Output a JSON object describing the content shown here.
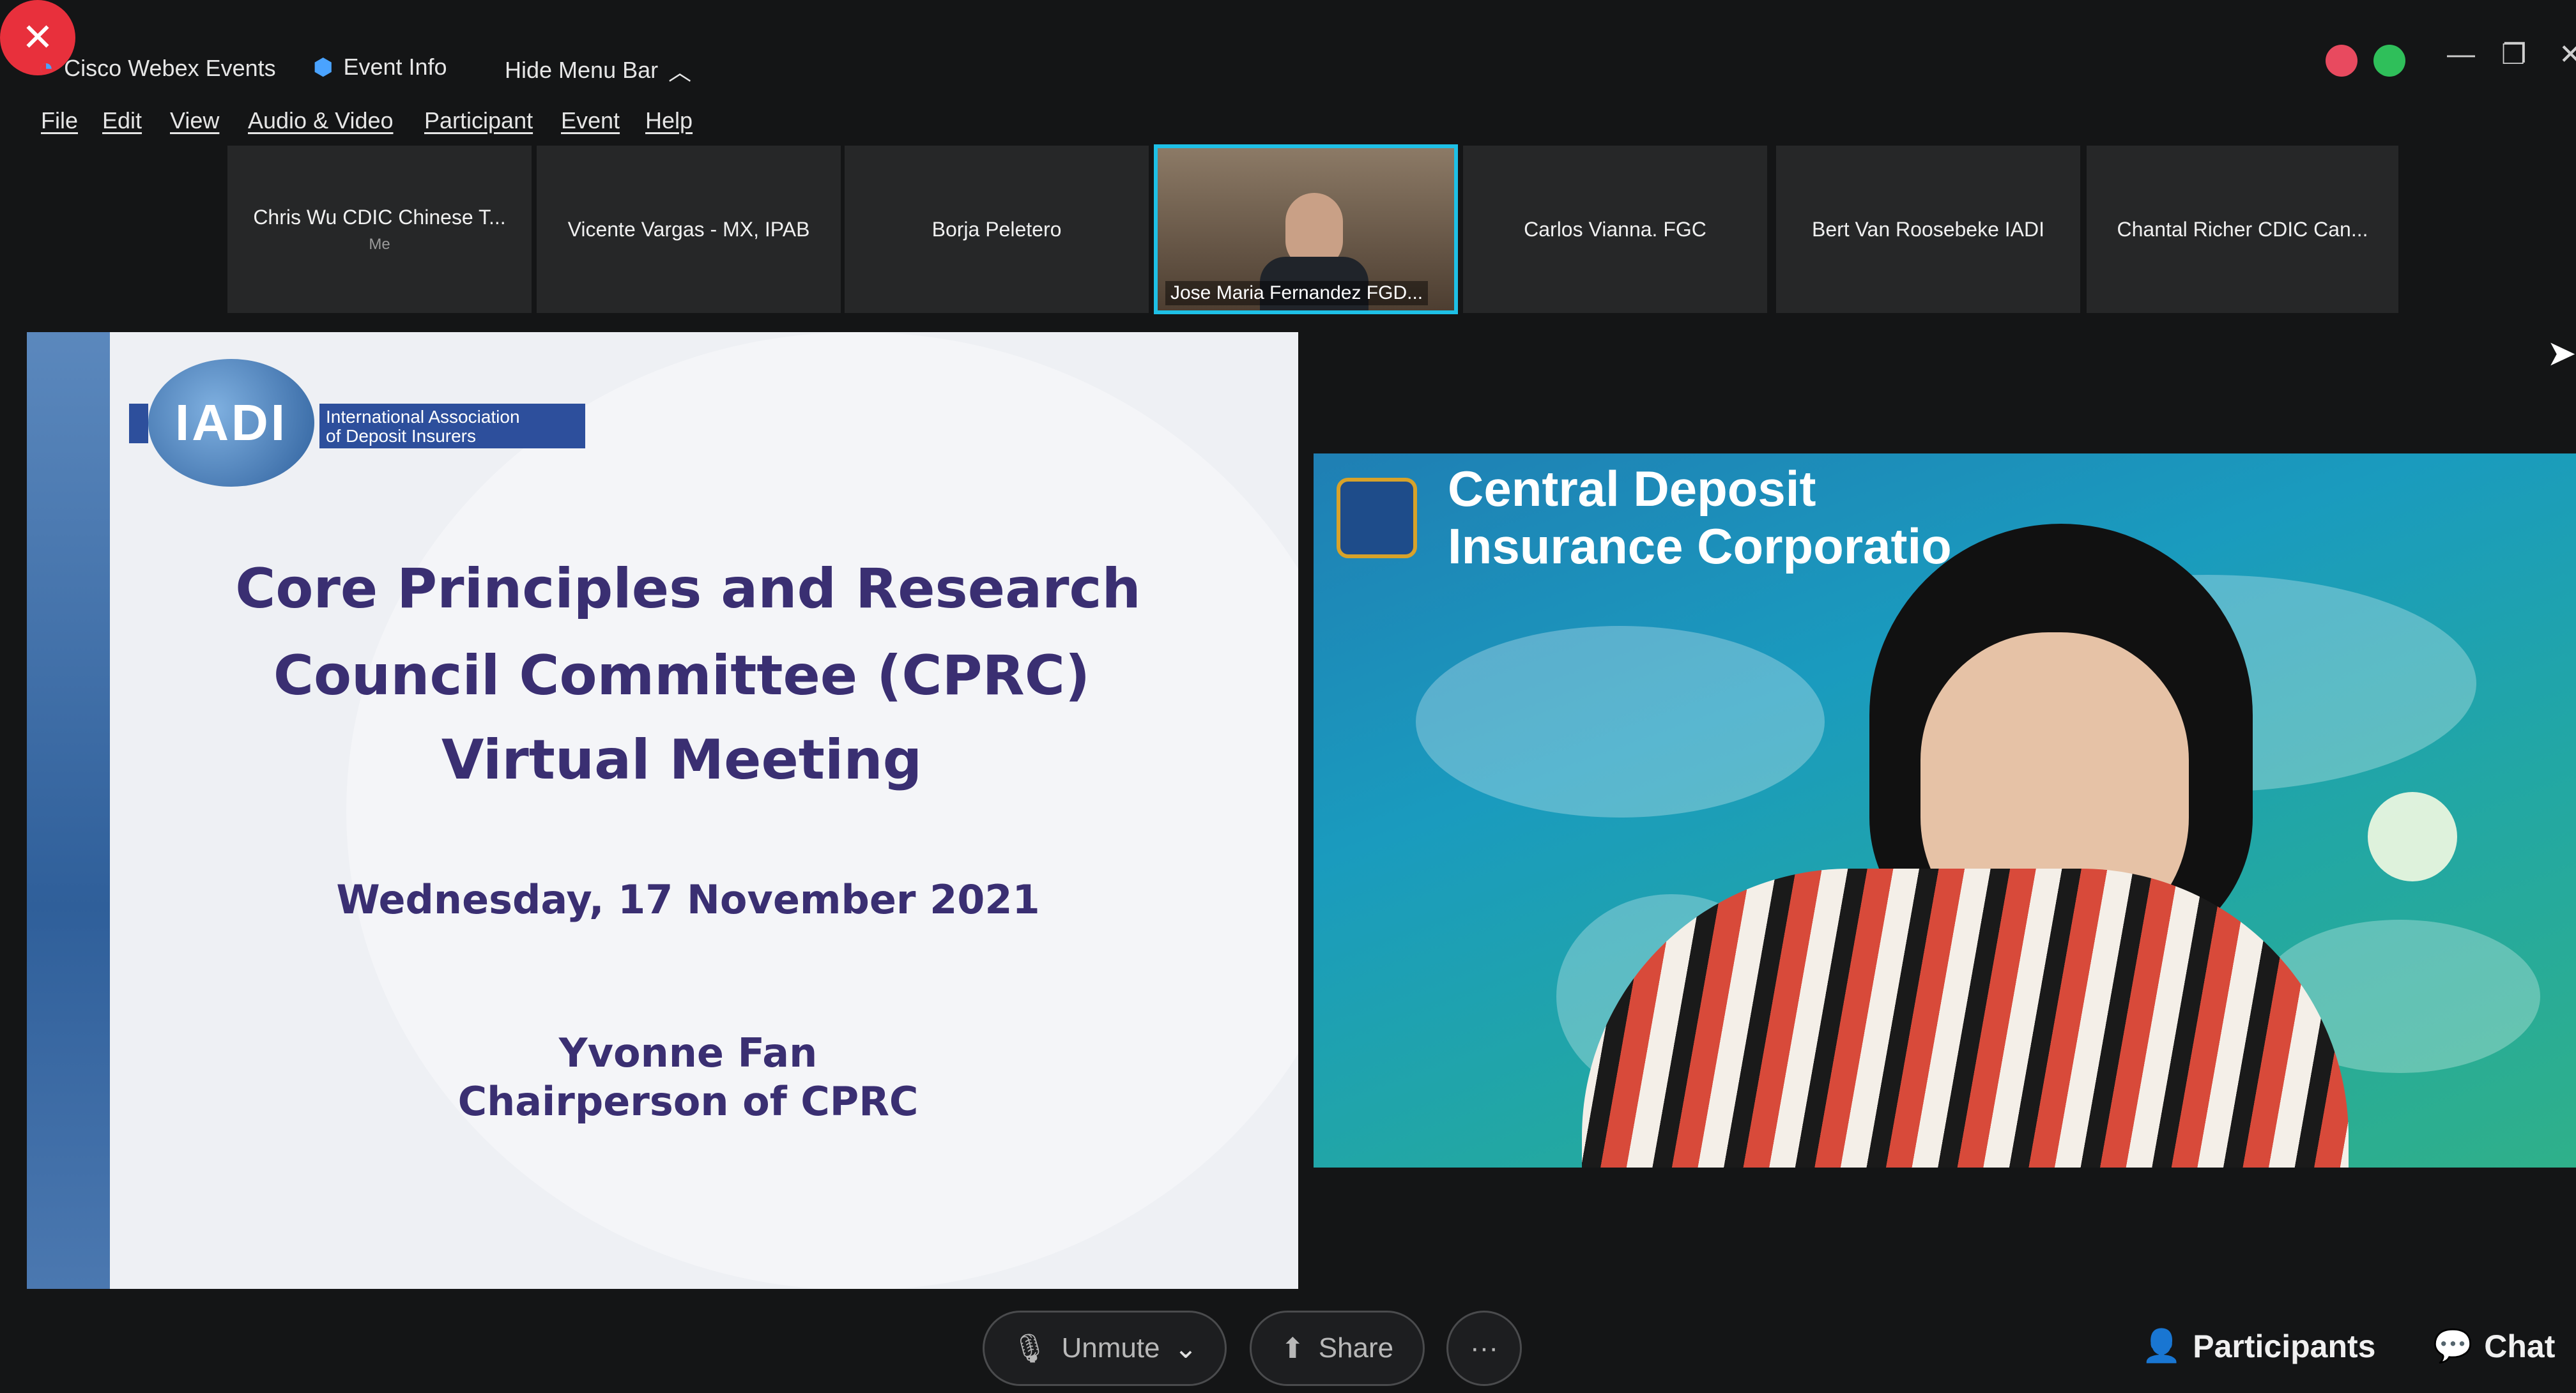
{
  "titlebar": {
    "app_name": "Cisco Webex Events",
    "event_info": "Event Info",
    "hide_menu": "Hide Menu Bar"
  },
  "menu": [
    "File",
    "Edit",
    "View",
    "Audio & Video",
    "Participant",
    "Event",
    "Help"
  ],
  "participants_strip": [
    {
      "name": "Chris Wu CDIC Chinese T...",
      "sub": "Me"
    },
    {
      "name": "Vicente Vargas - MX, IPAB"
    },
    {
      "name": "Borja Peletero"
    },
    {
      "name": "Jose Maria Fernandez FGD..."
    },
    {
      "name": "Carlos Vianna. FGC"
    },
    {
      "name": "Bert Van Roosebeke IADI"
    },
    {
      "name": "Chantal Richer CDIC Can..."
    }
  ],
  "slide": {
    "logo_text": "IADI",
    "logo_sub1": "International Association",
    "logo_sub2": "of Deposit Insurers",
    "title1": "Core Principles and Research",
    "title2": "Council Committee (CPRC)",
    "title3": "Virtual Meeting",
    "date": "Wednesday, 17 November 2021",
    "presenter": "Yvonne Fan",
    "presenter_role": "Chairperson of CPRC"
  },
  "video": {
    "banner1": "Central Deposit",
    "banner2": "Insurance Corporatio"
  },
  "controls": {
    "unmute": "Unmute",
    "share": "Share",
    "more": "···",
    "leave": "✕",
    "participants": "Participants",
    "chat": "Chat"
  },
  "colors": {
    "active_border": "#1ec0e6",
    "leave": "#e8303c",
    "slide_text": "#3a2f72"
  }
}
